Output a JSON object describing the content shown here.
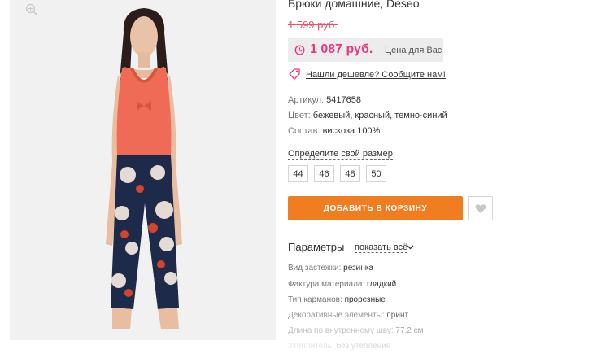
{
  "product": {
    "title": "Брюки домашние, Deseo",
    "old_price": "1 599 руб.",
    "price": "1 087 руб.",
    "price_note": "Цена для Вас",
    "cheaper_link": "Нашли дешевле? Сообщите нам!"
  },
  "info": {
    "article_label": "Артикул:",
    "article_value": "5417658",
    "color_label": "Цвет:",
    "color_value": "бежевый, красный, темно-синий",
    "composition_label": "Состав:",
    "composition_value": "вискоза 100%"
  },
  "size": {
    "link": "Определите свой размер",
    "options": [
      "44",
      "46",
      "48",
      "50"
    ]
  },
  "cart_button": "ДОБАВИТЬ В КОРЗИНУ",
  "params": {
    "title": "Параметры",
    "show_all": "показать всё",
    "rows": [
      {
        "label": "Вид застежки:",
        "value": "резинка"
      },
      {
        "label": "Фактура материала:",
        "value": "гладкий"
      },
      {
        "label": "Тип карманов:",
        "value": "прорезные"
      },
      {
        "label": "Декоративные элементы:",
        "value": "принт"
      },
      {
        "label": "Длина по внутреннему шву:",
        "value": "77.2 см"
      },
      {
        "label": "Утеплитель:",
        "value": "без утепления"
      }
    ]
  },
  "icons": {
    "zoom": "zoom-in-icon",
    "clock": "clock-icon",
    "tag": "price-tag-icon",
    "heart": "heart-icon",
    "chevron": "chevron-down-icon"
  },
  "colors": {
    "price": "#e5397f",
    "old_price": "#e05568",
    "cart_button": "#f07d1f"
  }
}
